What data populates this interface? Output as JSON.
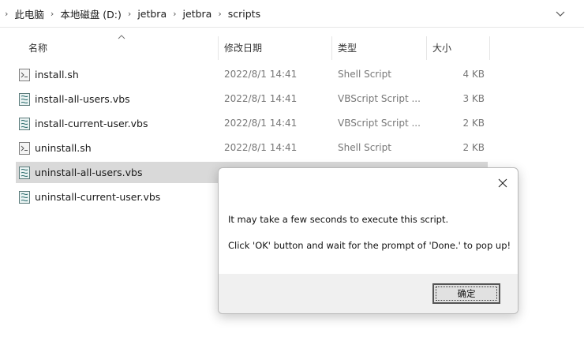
{
  "address": {
    "crumbs": [
      "此电脑",
      "本地磁盘 (D:)",
      "jetbra",
      "jetbra",
      "scripts"
    ]
  },
  "columns": {
    "name": "名称",
    "date": "修改日期",
    "type": "类型",
    "size": "大小"
  },
  "files": [
    {
      "name": "install.sh",
      "date": "2022/8/1 14:41",
      "type": "Shell Script",
      "size": "4 KB",
      "icon": "shell-script-icon"
    },
    {
      "name": "install-all-users.vbs",
      "date": "2022/8/1 14:41",
      "type": "VBScript Script ...",
      "size": "3 KB",
      "icon": "vbscript-icon"
    },
    {
      "name": "install-current-user.vbs",
      "date": "2022/8/1 14:41",
      "type": "VBScript Script ...",
      "size": "2 KB",
      "icon": "vbscript-icon"
    },
    {
      "name": "uninstall.sh",
      "date": "2022/8/1 14:41",
      "type": "Shell Script",
      "size": "2 KB",
      "icon": "shell-script-icon"
    },
    {
      "name": "uninstall-all-users.vbs",
      "date": "",
      "type": "",
      "size": "",
      "icon": "vbscript-icon"
    },
    {
      "name": "uninstall-current-user.vbs",
      "date": "",
      "type": "",
      "size": "",
      "icon": "vbscript-icon"
    }
  ],
  "selected_row": 4,
  "dialog": {
    "line1": "It may take a few seconds to execute this script.",
    "line2": "Click 'OK' button and wait for the prompt of 'Done.' to pop up!",
    "ok_label": "确定"
  },
  "colors": {
    "selection": "#d9d9d9",
    "dialog_footer": "#f0f0f0",
    "secondary_text": "#777777"
  }
}
